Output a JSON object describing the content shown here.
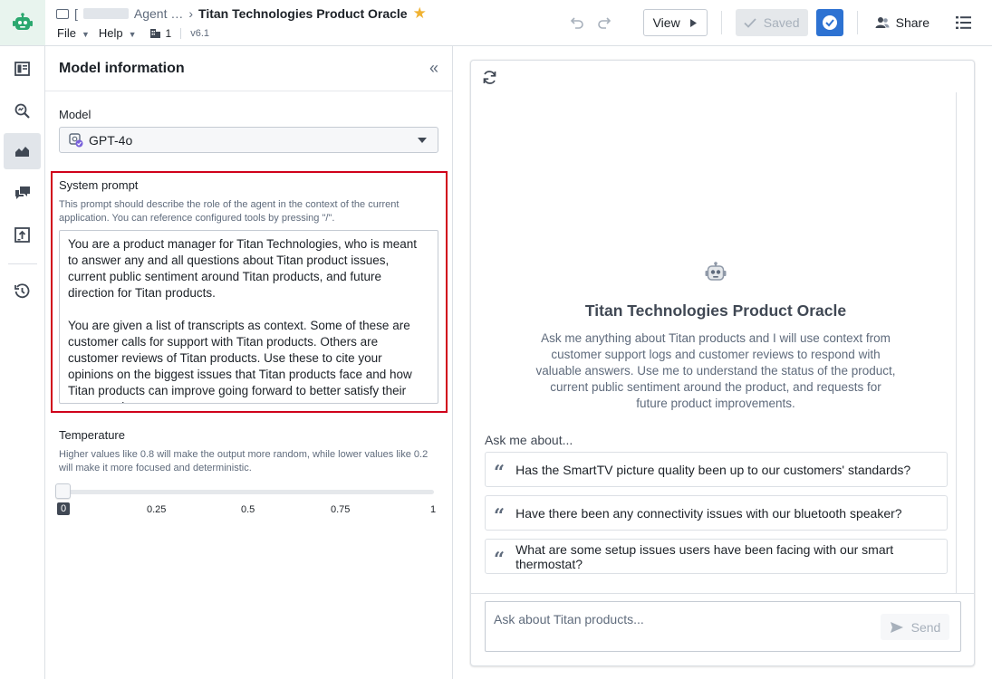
{
  "header": {
    "breadcrumb_prefix": "[",
    "breadcrumb_parent": "Agent …",
    "title": "Titan Technologies Product Oracle",
    "menus": [
      "File",
      "Help"
    ],
    "branch_count": "1",
    "version": "v6.1",
    "view_label": "View",
    "saved_label": "Saved",
    "share_label": "Share"
  },
  "rail": {
    "items": [
      "overview-icon",
      "search-icon",
      "analytics-icon",
      "chat-icon",
      "publish-icon",
      "history-icon"
    ],
    "active": "analytics-icon"
  },
  "panel": {
    "title": "Model information",
    "model_label": "Model",
    "model_value": "GPT-4o",
    "system_prompt_label": "System prompt",
    "system_prompt_hint": "This prompt should describe the role of the agent in the context of the current application. You can reference configured tools by pressing \"/\".",
    "system_prompt_p1": "You are a product manager for Titan Technologies, who is meant to answer any and all questions about Titan product issues, current public sentiment around Titan products, and future direction for Titan products.",
    "system_prompt_p2": "You are given a list of transcripts as context. Some of these are customer calls for support with Titan products. Others are customer reviews of Titan products. Use these to cite your opinions on the biggest issues that Titan products face and how Titan products can improve going forward to better satisfy their customer base.",
    "temperature_label": "Temperature",
    "temperature_hint": "Higher values like 0.8 will make the output more random, while lower values like 0.2 will make it more focused and deterministic.",
    "temperature_value": 0,
    "temperature_ticks": [
      "0",
      "0.25",
      "0.5",
      "0.75",
      "1"
    ]
  },
  "chat": {
    "title": "Titan Technologies Product Oracle",
    "description": "Ask me anything about Titan products and I will use context from customer support logs and customer reviews to respond with valuable answers. Use me to understand the status of the product, current public sentiment around the product, and requests for future product improvements.",
    "ask_label": "Ask me about...",
    "suggestions": [
      "Has the SmartTV picture quality been up to our customers' standards?",
      "Have there been any connectivity issues with our bluetooth speaker?",
      "What are some setup issues users have been facing with our smart thermostat?"
    ],
    "input_placeholder": "Ask about Titan products...",
    "send_label": "Send"
  },
  "colors": {
    "accent": "#2d72d2",
    "highlight_border": "#d0021b",
    "star": "#f0b232",
    "app_logo": "#2ba86f"
  }
}
